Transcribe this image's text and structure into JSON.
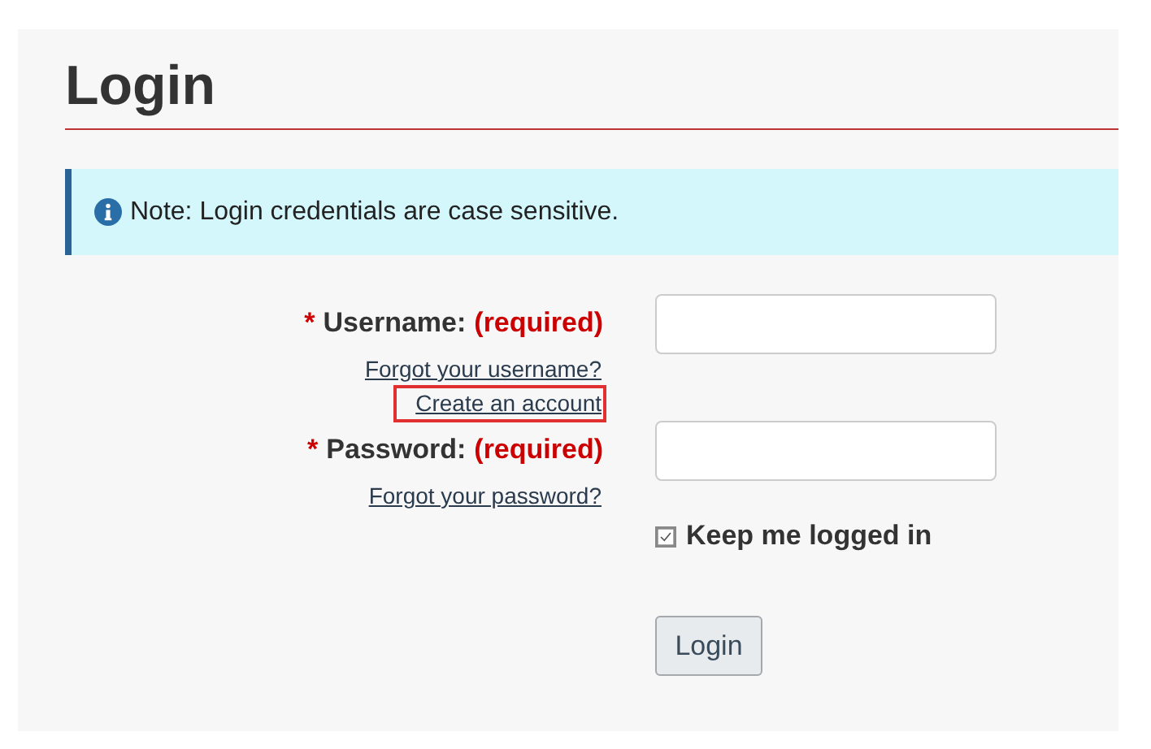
{
  "title": "Login",
  "note": {
    "text": "Note: Login credentials are case sensitive."
  },
  "fields": [
    {
      "required_mark": "*",
      "label": "Username:",
      "required_text": "(required)",
      "links": [
        {
          "text": "Forgot your username?",
          "highlighted": false
        },
        {
          "text": "Create an account",
          "highlighted": true
        }
      ]
    },
    {
      "required_mark": "*",
      "label": "Password:",
      "required_text": "(required)",
      "links": [
        {
          "text": "Forgot your password?",
          "highlighted": false
        }
      ]
    }
  ],
  "keep_logged_in": {
    "label": "Keep me logged in",
    "checked": true
  },
  "submit": {
    "label": "Login"
  }
}
